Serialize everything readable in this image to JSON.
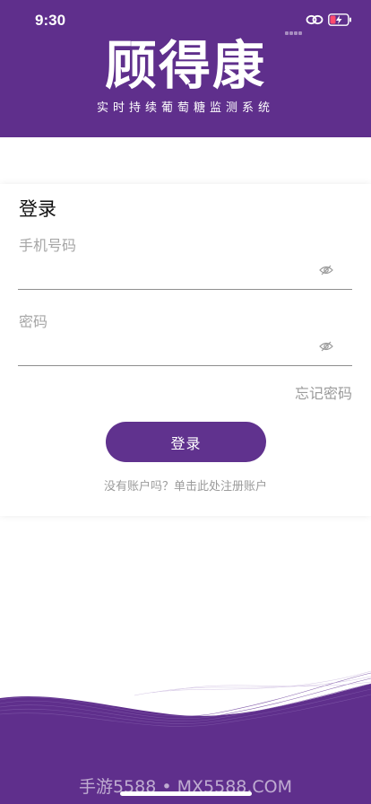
{
  "status_bar": {
    "time": "9:30"
  },
  "header": {
    "logo_text": "顾得康",
    "tagline": "实时持续葡萄糖监测系统"
  },
  "login": {
    "title": "登录",
    "phone_label": "手机号码",
    "phone_value": "",
    "password_label": "密码",
    "password_value": "",
    "forgot_password": "忘记密码",
    "submit_label": "登录",
    "register_prompt": "没有账户吗？单击此处注册账户"
  },
  "footer": {
    "watermark": "手游5588 • MX5588.COM"
  },
  "colors": {
    "brand_purple": "#5f2f8c",
    "button_purple": "#60328e",
    "label_gray": "#a6a6a6"
  }
}
